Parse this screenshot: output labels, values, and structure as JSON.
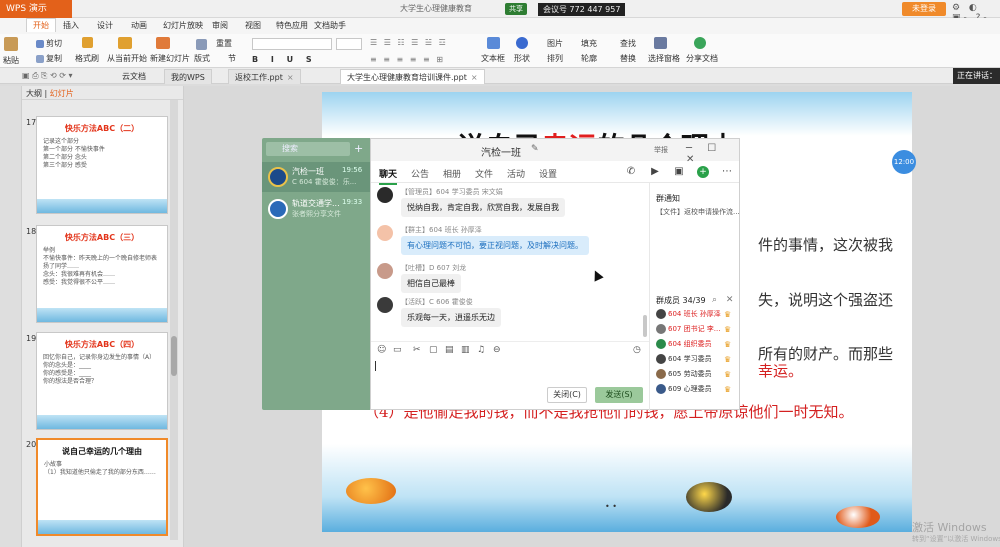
{
  "titlebar": {
    "app_name": "WPS 演示",
    "doc_title": "大学生心理健康教育",
    "meeting_badge": "共享",
    "meeting_id": "会议号 772 447 957",
    "login_label": "未登录",
    "controls": "⚙ ◐ ▣- ?-"
  },
  "ribbon_tabs": [
    "开始",
    "插入",
    "设计",
    "动画",
    "幻灯片放映",
    "审阅",
    "视图",
    "特色应用",
    "文档助手"
  ],
  "ribbon": {
    "paste": "粘贴",
    "cut": "剪切",
    "copy": "复制",
    "format_painter": "格式刷",
    "from_start": "从当前开始",
    "new_slide": "新建幻灯片",
    "layout": "版式",
    "section": "节",
    "reset": "重置",
    "textbox": "文本框",
    "shape": "形状",
    "arrange": "排列",
    "outline": "轮廓",
    "picture": "图片",
    "fill": "填充",
    "find": "查找",
    "replace": "替换",
    "select_pane": "选择窗格",
    "share_doc": "分享文档"
  },
  "quick_access": {
    "cloud_docs": "云文档",
    "tabs": [
      {
        "label": "我的WPS",
        "active": false
      },
      {
        "label": "返校工作.ppt",
        "active": false
      },
      {
        "label": "大学生心理健康教育培训课件.ppt",
        "active": true
      }
    ],
    "tooltip": "正在讲话："
  },
  "left_panel": {
    "tab_outline": "大纲",
    "tab_slides": "幻灯片",
    "thumbs": [
      {
        "num": "17",
        "title": "快乐方法ABC（二）",
        "body": "记录这个部分\n第一个部分 不愉快事件\n第二个部分 念头\n第三个部分 感受"
      },
      {
        "num": "18",
        "title": "快乐方法ABC（三）",
        "body": "举例\n不愉快事件：昨天晚上的一个晚自修老师表扬了同学……\n念头：我很难再有机会……\n感受：我觉得很不公平……"
      },
      {
        "num": "19",
        "title": "快乐方法ABC（四）",
        "body": "回忆你自己，记录你身边发生的事情（A）\n你的念头是：____\n你的感受是：____\n你的想法是否合理？"
      },
      {
        "num": "20",
        "title": "说自己幸运的几个理由",
        "body": "小故事\n（1）我知道他只偷走了我的部分东西……"
      }
    ]
  },
  "slide": {
    "title_part1": "说自己",
    "title_red": "幸运",
    "title_part2": "的几个理由",
    "line1": "件的事情，这次被我",
    "line2": "失，说明这个强盗还",
    "line3": "所有的财产。而那些",
    "line3_red": "幸运。",
    "line4": "（4）是他偷走我的钱，而不是我抢他们的钱，愿上帝原谅他们一时无知。",
    "time_bubble": "12:00"
  },
  "chat_list": {
    "search_placeholder": "搜索",
    "items": [
      {
        "name": "汽检一班",
        "time": "19:56",
        "msg": "C 604 霍俊俊：乐...",
        "selected": true
      },
      {
        "name": "轨道交通学...",
        "time": "19:33",
        "msg": "张者熙分享文件"
      }
    ]
  },
  "chat": {
    "title": "汽检一班",
    "report": "举报",
    "tabs": [
      "聊天",
      "公告",
      "相册",
      "文件",
      "活动",
      "设置"
    ],
    "messages": [
      {
        "sender": "【管理员】604 学习委员 宋文娟",
        "text": "悦纳自我，肯定自我，欣赏自我，发展自我",
        "highlight": false
      },
      {
        "sender": "【群主】604 班长 孙厚泽",
        "text": "有心理问题不可怕，要正视问题，及时解决问题。",
        "highlight": true
      },
      {
        "sender": "【吐槽】D 607 刘龙",
        "text": "相信自己最棒",
        "highlight": false
      },
      {
        "sender": "【活跃】C 606 霍俊俊",
        "text": "乐观每一天，逍遥乐无边",
        "highlight": false
      }
    ],
    "notice_title": "群通知",
    "notice_text": "【文件】返校申请操作流...",
    "members_title": "群成员 34/39",
    "members": [
      {
        "name": "604 班长 孙厚泽",
        "red": true
      },
      {
        "name": "607 团书记 李...",
        "red": true
      },
      {
        "name": "604 组织委员",
        "red": true
      },
      {
        "name": "604 学习委员",
        "red": false
      },
      {
        "name": "605 劳动委员",
        "red": false
      },
      {
        "name": "609 心理委员",
        "red": false
      }
    ],
    "close_label": "关闭(C)",
    "send_label": "发送(S)"
  },
  "watermark": {
    "line1": "激活 Windows",
    "line2": "转到“设置”以激活 Windows。"
  }
}
